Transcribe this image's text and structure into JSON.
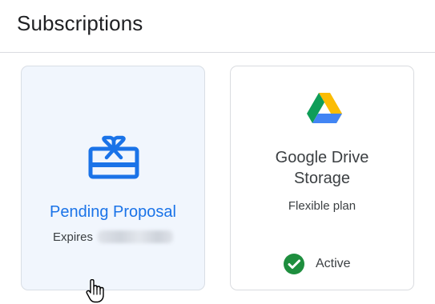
{
  "header": {
    "title": "Subscriptions"
  },
  "cards": {
    "pending": {
      "icon": "gift-card-icon",
      "title": "Pending Proposal",
      "expires_label": "Expires",
      "expires_date_redacted": true
    },
    "drive": {
      "icon": "google-drive-icon",
      "title_line1": "Google Drive",
      "title_line2": "Storage",
      "plan": "Flexible plan",
      "status": "Active",
      "status_icon": "check-circle-icon"
    }
  },
  "colors": {
    "accent": "#1a73e8",
    "status_green": "#1e8e3e",
    "pending_card_bg": "#f1f6fd"
  }
}
